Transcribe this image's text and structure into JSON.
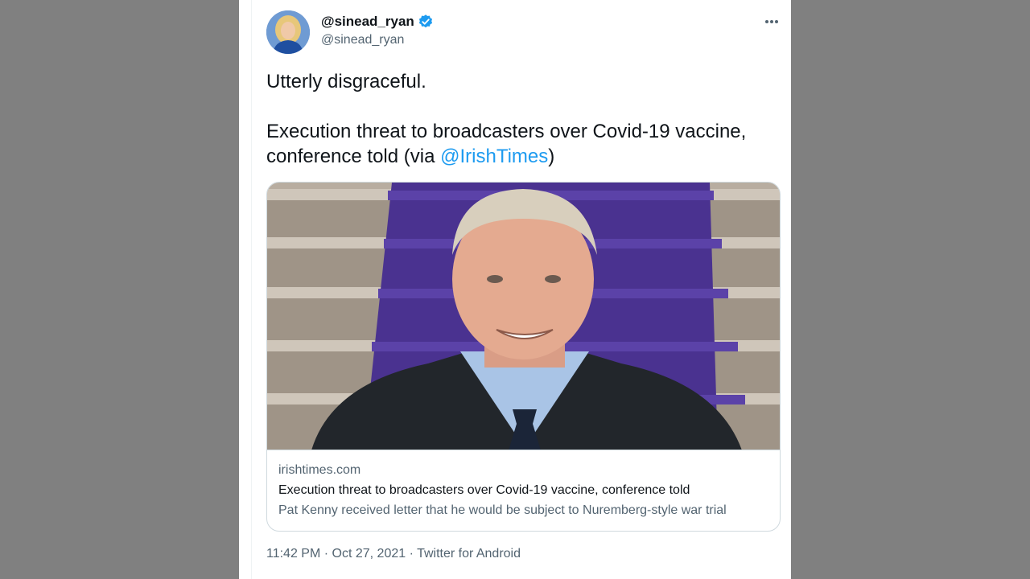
{
  "tweet": {
    "display_name": "@sinead_ryan",
    "handle": "@sinead_ryan",
    "verified": true,
    "text_line1": "Utterly disgraceful.",
    "text_line2_prefix": "Execution threat to broadcasters over Covid-19 vaccine, conference told (via ",
    "mention": "@IrishTimes",
    "text_line2_suffix": ")",
    "timestamp": "11:42 PM · Oct 27, 2021 · Twitter for Android"
  },
  "card": {
    "domain": "irishtimes.com",
    "title": "Execution threat to broadcasters over Covid-19 vaccine, conference told",
    "description": "Pat Kenny received letter that he would be subject to Nuremberg-style war trial",
    "image": "photo-of-man-smiling-on-purple-carpeted-stairs"
  },
  "icons": {
    "verified": "verified-badge-icon",
    "more": "more-options-icon"
  },
  "colors": {
    "accent": "#1d9bf0",
    "text": "#0f1419",
    "secondary": "#536471",
    "background": "#808080"
  }
}
